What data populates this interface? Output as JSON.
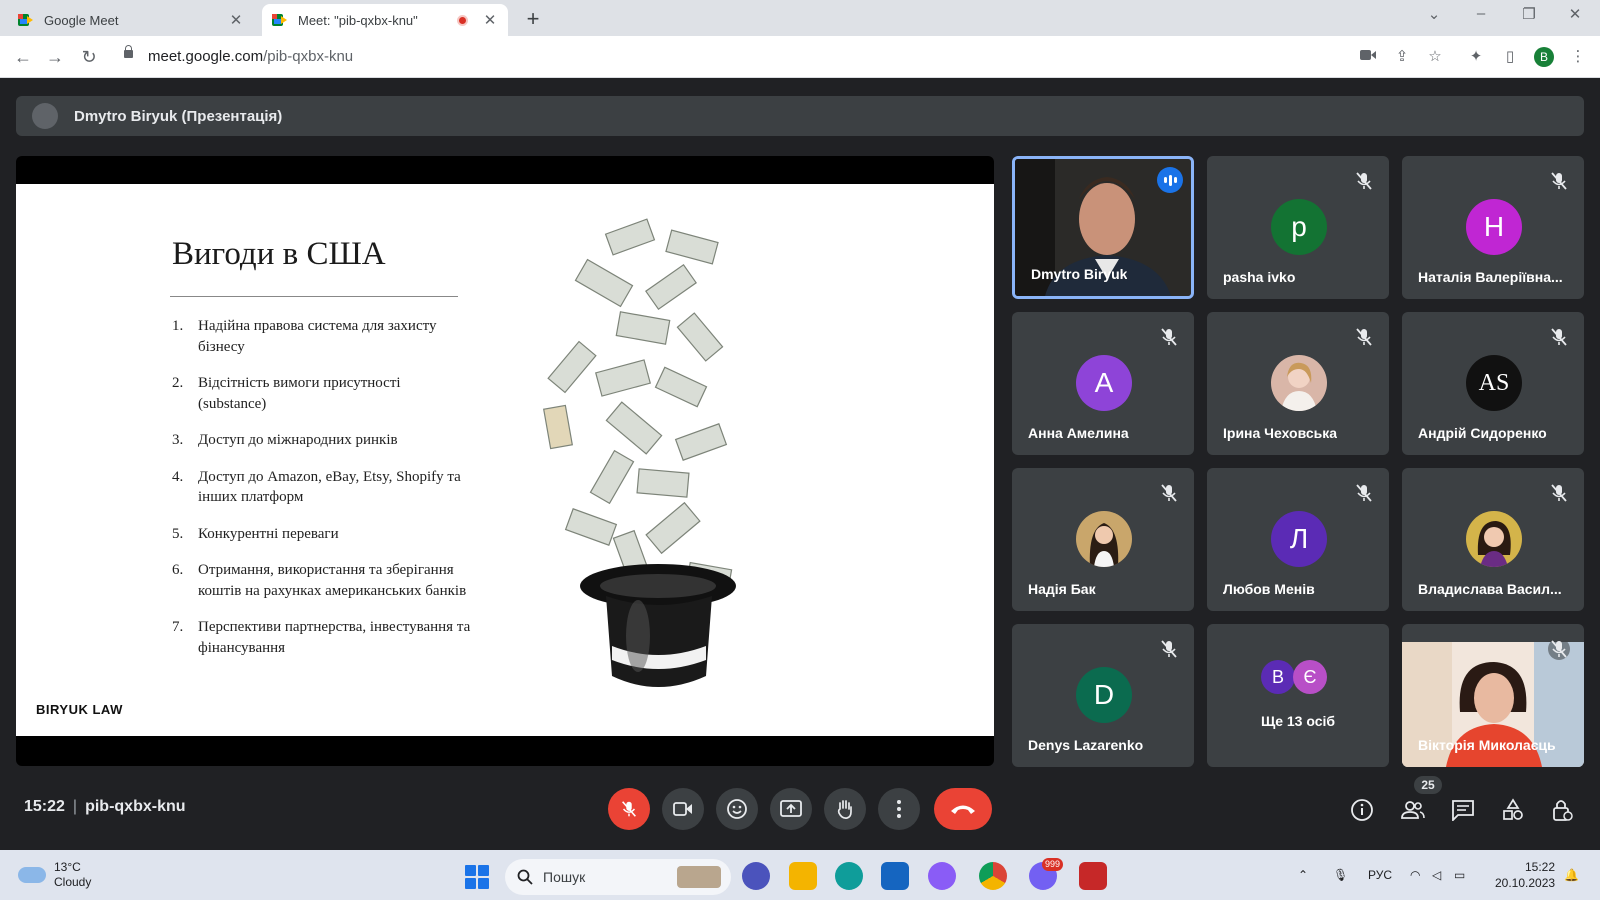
{
  "browser": {
    "tabs": [
      {
        "title": "Google Meet"
      },
      {
        "title": "Meet: \"pib-qxbx-knu\""
      }
    ],
    "url_host": "meet.google.com",
    "url_path": "/pib-qxbx-knu",
    "profile_initial": "B"
  },
  "meet": {
    "presenter_bar": "Dmytro Biryuk (Презентація)",
    "slide": {
      "title": "Вигоди в США",
      "items": [
        {
          "num": "1.",
          "text": "Надійна правова система для захисту бізнесу"
        },
        {
          "num": "2.",
          "text": "Відсітність вимоги присутності (substance)"
        },
        {
          "num": "3.",
          "text": "Доступ до міжнародних ринків"
        },
        {
          "num": "4.",
          "text": "Доступ до Amazon, eBay, Etsy, Shopify та інших платформ"
        },
        {
          "num": "5.",
          "text": "Конкурентні переваги"
        },
        {
          "num": "6.",
          "text": "Отримання, використання та зберігання коштів на рахунках американських банків"
        },
        {
          "num": "7.",
          "text": "Перспективи партнерства, інвестування та фінансування"
        }
      ],
      "brand": "BIRYUK LAW"
    },
    "participants": [
      {
        "name": "Dmytro Biryuk",
        "initial": "",
        "color": "",
        "speaking": true
      },
      {
        "name": "pasha ivko",
        "initial": "p",
        "color": "#137333"
      },
      {
        "name": "Наталія Валеріївна...",
        "initial": "Н",
        "color": "#c026d3"
      },
      {
        "name": "Анна Амелина",
        "initial": "А",
        "color": "#8e44d8"
      },
      {
        "name": "Ірина Чеховська",
        "initial": "",
        "color": "#d9b6a8"
      },
      {
        "name": "Андрій Сидоренко",
        "initial": "AS",
        "color": "#111111"
      },
      {
        "name": "Надія Бак",
        "initial": "",
        "color": "#c9a66b"
      },
      {
        "name": "Любов Менів",
        "initial": "Л",
        "color": "#5b2bb5"
      },
      {
        "name": "Владислава Васил...",
        "initial": "",
        "color": "#d4b44a"
      },
      {
        "name": "Denys Lazarenko",
        "initial": "D",
        "color": "#0b6b4f"
      },
      {
        "name": "Ще 13 осіб",
        "initials": [
          "В",
          "Є"
        ],
        "colors": [
          "#5b2bb5",
          "#b84fc7"
        ]
      },
      {
        "name": "Вікторія Миколаєць",
        "initial": "",
        "color": "#f2e6dc"
      }
    ],
    "time": "15:22",
    "meeting_code": "pib-qxbx-knu",
    "participant_count": "25"
  },
  "taskbar": {
    "weather_temp": "13°C",
    "weather_desc": "Cloudy",
    "search_placeholder": "Пошук",
    "notif_badge": "999",
    "lang": "РУС",
    "clock_time": "15:22",
    "clock_date": "20.10.2023"
  },
  "colors": {
    "accent": "#8ab4f8",
    "danger": "#ea4335",
    "surface": "#3c4043",
    "background": "#202124"
  }
}
